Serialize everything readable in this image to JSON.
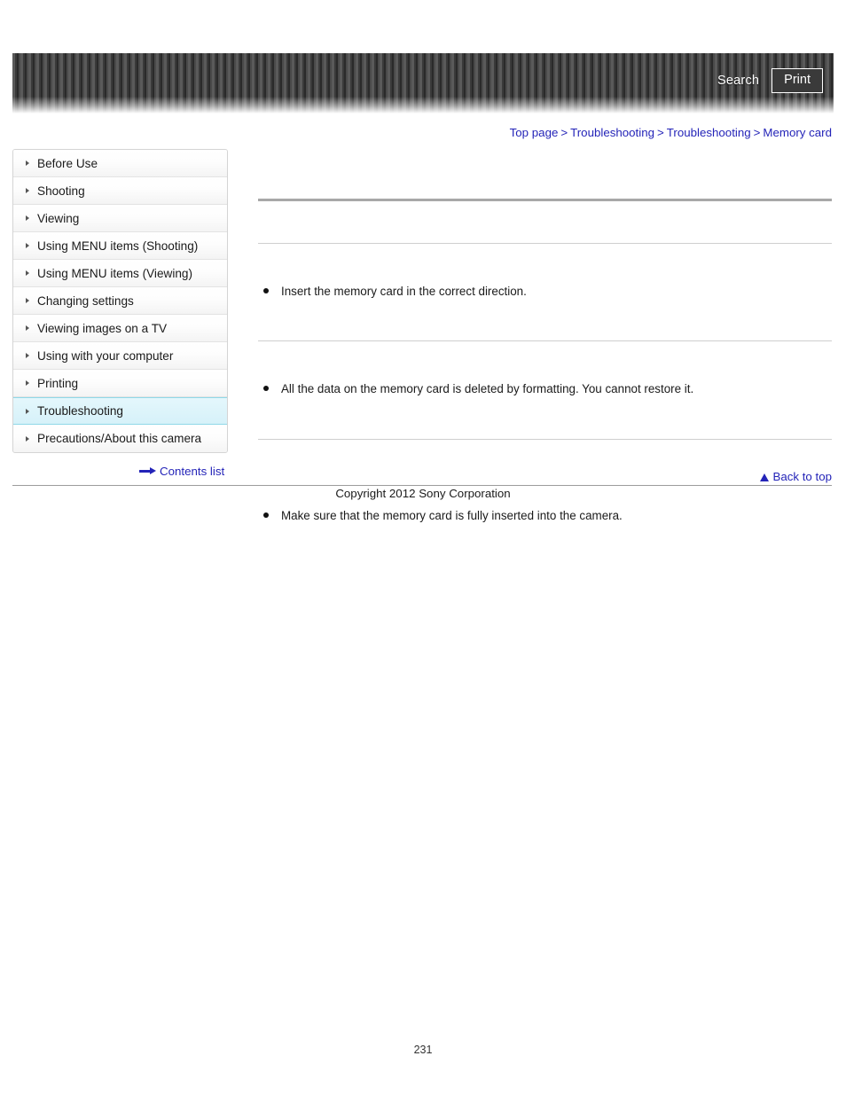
{
  "header": {
    "search_label": "Search",
    "print_label": "Print",
    "search_icon": "search-icon",
    "print_icon": "printer-icon"
  },
  "breadcrumb": {
    "separator": ">",
    "items": [
      {
        "label": "Top page"
      },
      {
        "label": "Troubleshooting"
      },
      {
        "label": "Troubleshooting"
      },
      {
        "label": "Memory card"
      }
    ]
  },
  "sidebar": {
    "items": [
      {
        "label": "Before Use",
        "active": false
      },
      {
        "label": "Shooting",
        "active": false
      },
      {
        "label": "Viewing",
        "active": false
      },
      {
        "label": "Using MENU items (Shooting)",
        "active": false
      },
      {
        "label": "Using MENU items (Viewing)",
        "active": false
      },
      {
        "label": "Changing settings",
        "active": false
      },
      {
        "label": "Viewing images on a TV",
        "active": false
      },
      {
        "label": "Using with your computer",
        "active": false
      },
      {
        "label": "Printing",
        "active": false
      },
      {
        "label": "Troubleshooting",
        "active": true
      },
      {
        "label": "Precautions/About this camera",
        "active": false
      }
    ],
    "contents_list_label": "Contents list",
    "contents_list_icon": "arrow-right-icon"
  },
  "main": {
    "bullets": [
      {
        "text": "Insert the memory card in the correct direction."
      },
      {
        "text": "All the data on the memory card is deleted by formatting. You cannot restore it."
      },
      {
        "text": "Make sure that the memory card is fully inserted into the camera."
      }
    ],
    "back_to_top_label": "Back to top",
    "back_to_top_icon": "triangle-up-icon"
  },
  "footer": {
    "copyright": "Copyright 2012 Sony Corporation",
    "page_number": "231"
  },
  "colors": {
    "link": "#2424b8",
    "active_item_bg": "#d6f1f9",
    "active_item_border": "#8fd8e8",
    "rule_thick": "#a8a8a8",
    "rule_thin": "#cfcfcf"
  }
}
